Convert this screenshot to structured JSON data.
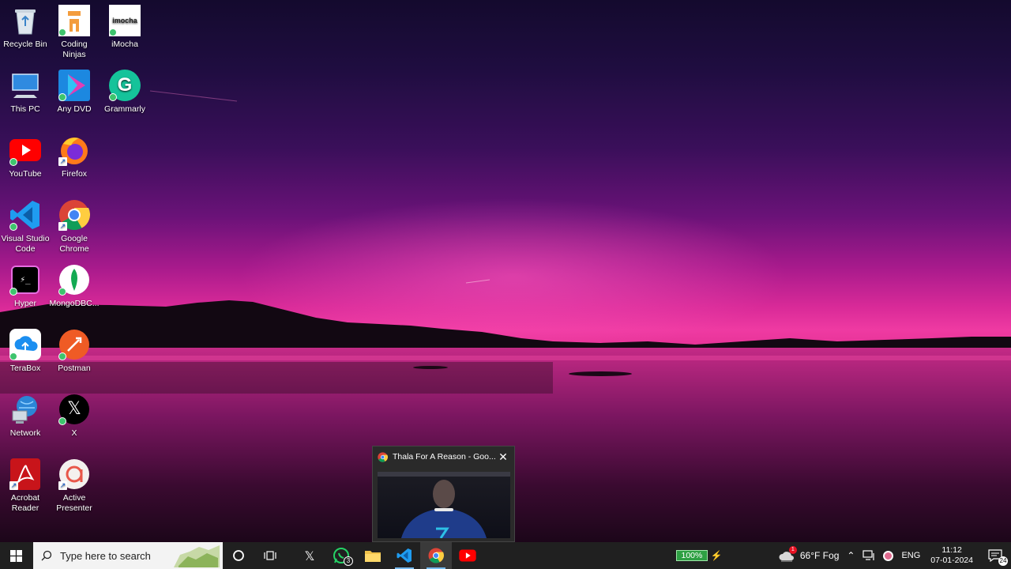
{
  "desktop_icons": [
    {
      "label": "Recycle Bin",
      "icon": "recycle-bin-icon"
    },
    {
      "label": "Coding Ninjas",
      "icon": "coding-ninjas-icon"
    },
    {
      "label": "iMocha",
      "icon": "imocha-icon",
      "icon_text": "imocha"
    },
    {
      "label": "This PC",
      "icon": "this-pc-icon"
    },
    {
      "label": "Any DVD",
      "icon": "any-dvd-icon"
    },
    {
      "label": "Grammarly",
      "icon": "grammarly-icon",
      "icon_text": "G"
    },
    {
      "label": "YouTube",
      "icon": "youtube-icon"
    },
    {
      "label": "Firefox",
      "icon": "firefox-icon"
    },
    {
      "label": "Visual Studio Code",
      "icon": "vscode-icon"
    },
    {
      "label": "Google Chrome",
      "icon": "chrome-icon"
    },
    {
      "label": "Hyper",
      "icon": "hyper-icon",
      "icon_text": "⚡_"
    },
    {
      "label": "MongoDBC...",
      "icon": "mongodb-compass-icon"
    },
    {
      "label": "TeraBox",
      "icon": "terabox-icon"
    },
    {
      "label": "Postman",
      "icon": "postman-icon"
    },
    {
      "label": "Network",
      "icon": "network-icon"
    },
    {
      "label": "X",
      "icon": "x-icon",
      "icon_text": "𝕏"
    },
    {
      "label": "Acrobat Reader",
      "icon": "acrobat-reader-icon"
    },
    {
      "label": "Active Presenter",
      "icon": "active-presenter-icon"
    }
  ],
  "preview": {
    "title": "Thala For A Reason - Goo...",
    "close_label": "✕"
  },
  "taskbar": {
    "search_placeholder": "Type here to search",
    "apps": [
      {
        "name": "x-taskbar-icon",
        "label": "𝕏"
      },
      {
        "name": "whatsapp-taskbar-icon",
        "badge": "3"
      },
      {
        "name": "file-explorer-taskbar-icon"
      },
      {
        "name": "vscode-taskbar-icon"
      },
      {
        "name": "chrome-taskbar-icon",
        "active": true
      },
      {
        "name": "youtube-taskbar-icon"
      }
    ],
    "battery": "100%",
    "weather": "66°F Fog",
    "weather_alert": "1",
    "language": "ENG",
    "time": "11:12",
    "date": "07-01-2024",
    "notifications": "24"
  },
  "colors": {
    "taskbar_bg": "#202020",
    "accent_active": "#76b9ed",
    "battery_green": "#2ea043"
  }
}
